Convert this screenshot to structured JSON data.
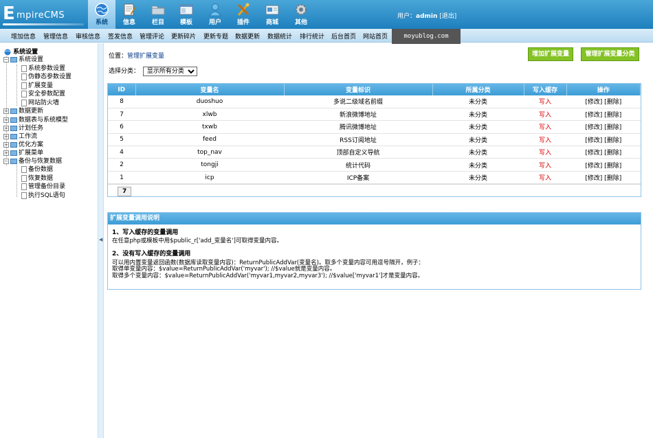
{
  "app": {
    "logo_initial": "E",
    "logo_rest": "mpireCMS"
  },
  "topmenu": [
    {
      "label": "系统",
      "icon": "globe-icon",
      "active": true
    },
    {
      "label": "信息",
      "icon": "notepad-icon"
    },
    {
      "label": "栏目",
      "icon": "folder-icon"
    },
    {
      "label": "模板",
      "icon": "window-icon"
    },
    {
      "label": "用户",
      "icon": "user-icon"
    },
    {
      "label": "插件",
      "icon": "tools-icon"
    },
    {
      "label": "商城",
      "icon": "card-icon"
    },
    {
      "label": "其他",
      "icon": "gear-icon"
    }
  ],
  "user": {
    "prefix": "用户：",
    "name": "admin",
    "logout": "[退出]"
  },
  "subnav": [
    "增加信息",
    "管理信息",
    "审核信息",
    "签发信息",
    "管理评论",
    "更新碎片",
    "更新专题",
    "数据更新",
    "数据统计",
    "排行统计",
    "后台首页",
    "网站首页"
  ],
  "watermark": "moyublog.com",
  "tree": {
    "root": "系统设置",
    "nodes": [
      {
        "label": "系统设置",
        "type": "folder",
        "expanded": true
      },
      {
        "label": "系统参数设置",
        "type": "page"
      },
      {
        "label": "伪静态参数设置",
        "type": "page"
      },
      {
        "label": "扩展变量",
        "type": "page"
      },
      {
        "label": "安全参数配置",
        "type": "page"
      },
      {
        "label": "网站防火墙",
        "type": "page"
      },
      {
        "label": "数据更新",
        "type": "folder"
      },
      {
        "label": "数据表与系统模型",
        "type": "folder"
      },
      {
        "label": "计划任务",
        "type": "folder"
      },
      {
        "label": "工作流",
        "type": "folder"
      },
      {
        "label": "优化方案",
        "type": "folder"
      },
      {
        "label": "扩展菜单",
        "type": "folder"
      },
      {
        "label": "备份与恢复数据",
        "type": "folder",
        "expanded": true
      },
      {
        "label": "备份数据",
        "type": "page"
      },
      {
        "label": "恢复数据",
        "type": "page"
      },
      {
        "label": "管理备份目录",
        "type": "page"
      },
      {
        "label": "执行SQL语句",
        "type": "page"
      }
    ]
  },
  "main": {
    "crumb_prefix": "位置：",
    "crumb_link": "管理扩展变量",
    "btn_add": "增加扩展变量",
    "btn_manage_class": "管理扩展变量分类",
    "filter_label": "选择分类：",
    "filter_value": "显示所有分类",
    "table": {
      "headers": [
        "ID",
        "变量名",
        "变量标识",
        "所属分类",
        "写入缓存",
        "操作"
      ],
      "rows": [
        [
          "8",
          "duoshuo",
          "多说二级域名前缀",
          "未分类",
          "写入",
          "[修改] [删除]"
        ],
        [
          "7",
          "xlwb",
          "新浪微博地址",
          "未分类",
          "写入",
          "[修改] [删除]"
        ],
        [
          "6",
          "txwb",
          "腾讯微博地址",
          "未分类",
          "写入",
          "[修改] [删除]"
        ],
        [
          "5",
          "feed",
          "RSS订阅地址",
          "未分类",
          "写入",
          "[修改] [删除]"
        ],
        [
          "4",
          "top_nav",
          "顶部自定义导航",
          "未分类",
          "写入",
          "[修改] [删除]"
        ],
        [
          "2",
          "tongji",
          "统计代码",
          "未分类",
          "写入",
          "[修改] [删除]"
        ],
        [
          "1",
          "icp",
          "ICP备案",
          "未分类",
          "写入",
          "[修改] [删除]"
        ]
      ],
      "page_num": "7"
    },
    "help": {
      "title": "扩展变量调用说明",
      "s1_title": "1、写入缓存的变量调用",
      "s1_text": "在任意php或模板中用$public_r['add_变量名']可取得变量内容。",
      "s2_title": "2、没有写入缓存的变量调用",
      "s2_line1": "可以用内置变量返回函数(数据库读取变量内容)：ReturnPublicAddVar(变量名)。取多个变量内容可用逗号隔开，例子：",
      "s2_line2": "取得单变量内容：$value=ReturnPublicAddVar('myvar'); //$value就是变量内容。",
      "s2_line3": "取得多个变量内容：$value=ReturnPublicAddVar('myvar1,myvar2,myvar3'); //$value['myvar1']才是变量内容。"
    }
  }
}
